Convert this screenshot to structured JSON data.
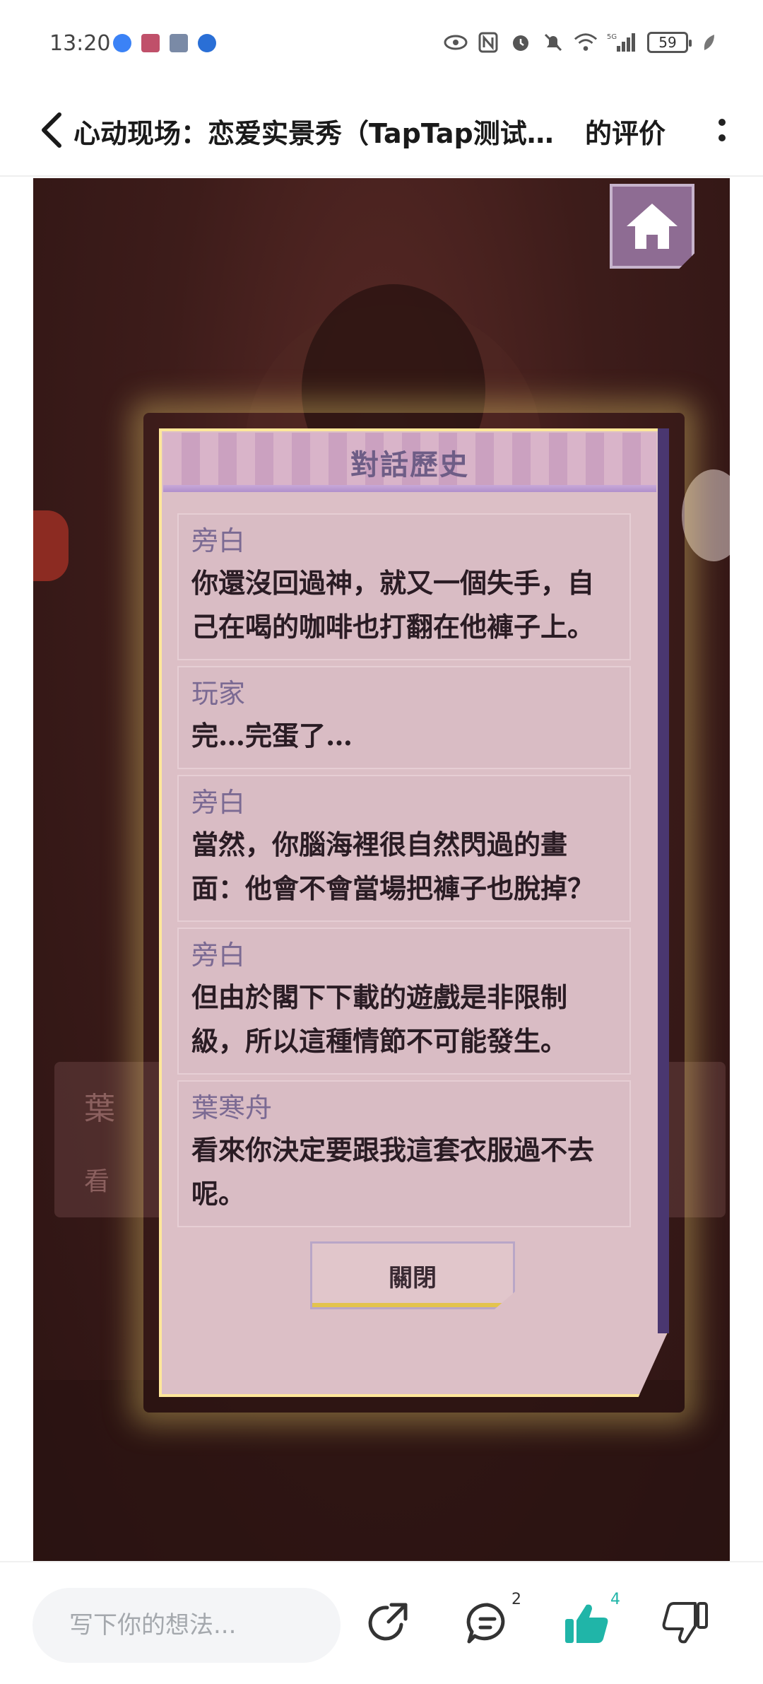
{
  "status_bar": {
    "time": "13:20",
    "battery": "59",
    "network": "5G"
  },
  "header": {
    "title": "心动现场：恋爱实景秀（TapTap测试…",
    "suffix": "的评价"
  },
  "game": {
    "background_name": "葉",
    "background_text": "看"
  },
  "dialog_history": {
    "title": "對話歷史",
    "entries": [
      {
        "speaker": "旁白",
        "text": "你還沒回過神，就又一個失手，自己在喝的咖啡也打翻在他褲子上。"
      },
      {
        "speaker": "玩家",
        "text": "完…完蛋了…"
      },
      {
        "speaker": "旁白",
        "text": "當然，你腦海裡很自然閃過的畫面：他會不會當場把褲子也脫掉？"
      },
      {
        "speaker": "旁白",
        "text": "但由於閣下下載的遊戲是非限制級，所以這種情節不可能發生。"
      },
      {
        "speaker": "葉寒舟",
        "text": "看來你決定要跟我這套衣服過不去呢。"
      }
    ],
    "close_label": "關閉"
  },
  "bottom_bar": {
    "comment_placeholder": "写下你的想法...",
    "comment_count": "2",
    "like_count": "4"
  },
  "colors": {
    "accent_green": "#20b5a8",
    "modal_bg": "#dcbfc6",
    "speaker_color": "#7b6a93"
  }
}
